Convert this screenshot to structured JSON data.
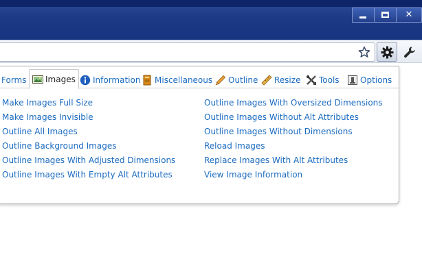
{
  "window": {
    "controls": {
      "minimize_icon": "minimize-icon",
      "maximize_icon": "maximize-icon",
      "close_label": "✕"
    },
    "colors": {
      "titlebar": "#1d3a86",
      "link": "#1c6cc1"
    }
  },
  "toolbar": {
    "bookmark_icon": "star-icon",
    "extension_icon": "gear-icon",
    "menu_icon": "wrench-icon"
  },
  "panel": {
    "tabs": [
      {
        "label": "Forms",
        "icon": ""
      },
      {
        "label": "Images",
        "icon": "image-icon",
        "active": true
      },
      {
        "label": "Information",
        "icon": "info-icon"
      },
      {
        "label": "Miscellaneous",
        "icon": "notebook-icon"
      },
      {
        "label": "Outline",
        "icon": "pencil-icon"
      },
      {
        "label": "Resize",
        "icon": "ruler-icon"
      },
      {
        "label": "Tools",
        "icon": "tools-icon"
      },
      {
        "label": "Options",
        "icon": "options-icon"
      }
    ],
    "left_column": [
      "Make Images Full Size",
      "Make Images Invisible",
      "Outline All Images",
      "Outline Background Images",
      "Outline Images With Adjusted Dimensions",
      "Outline Images With Empty Alt Attributes"
    ],
    "right_column": [
      "Outline Images With Oversized Dimensions",
      "Outline Images Without Alt Attributes",
      "Outline Images Without Dimensions",
      "Reload Images",
      "Replace Images With Alt Attributes",
      "View Image Information"
    ]
  }
}
